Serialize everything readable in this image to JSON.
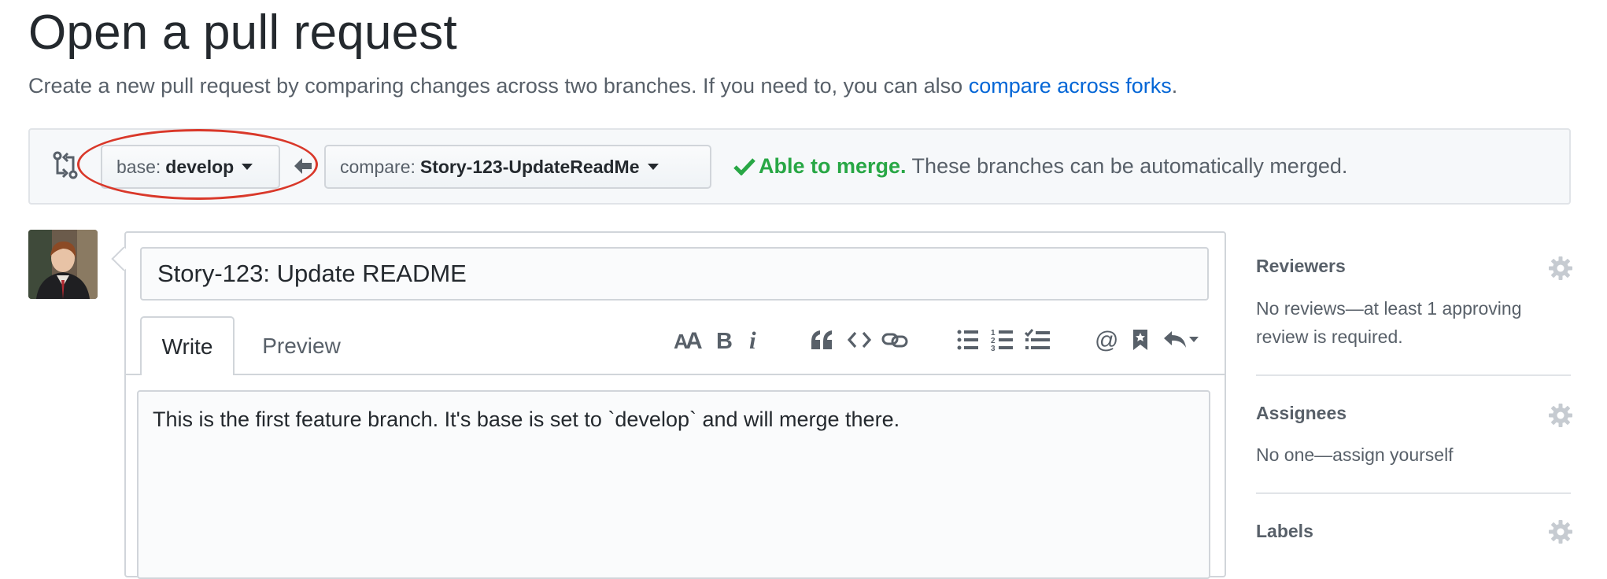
{
  "page": {
    "title": "Open a pull request",
    "subtitle_text": "Create a new pull request by comparing changes across two branches. If you need to, you can also ",
    "subtitle_link": "compare across forks",
    "subtitle_end": "."
  },
  "range": {
    "base_prefix": "base:",
    "base_value": "develop",
    "compare_prefix": "compare:",
    "compare_value": "Story-123-UpdateReadMe",
    "merge_ok": "Able to merge.",
    "merge_text": " These branches can be automatically merged.",
    "highlight_color": "#d9382a",
    "merge_color": "#28a745"
  },
  "composer": {
    "title_value": "Story-123: Update README",
    "tabs": [
      "Write",
      "Preview"
    ],
    "body_value": "This is the first feature branch. It's base is set to `develop` and will merge there.",
    "toolbar": [
      "text-size-icon",
      "bold-icon",
      "italic-icon",
      "quote-icon",
      "code-icon",
      "link-icon",
      "bulleted-list-icon",
      "numbered-list-icon",
      "task-list-icon",
      "mention-icon",
      "bookmark-icon",
      "reply-icon"
    ]
  },
  "sidebar": {
    "reviewers_label": "Reviewers",
    "reviewers_text_1": "No reviews—at least 1 approving",
    "reviewers_text_2": "review is required.",
    "assignees_label": "Assignees",
    "assignees_text": "No one—assign yourself",
    "labels_label": "Labels"
  }
}
